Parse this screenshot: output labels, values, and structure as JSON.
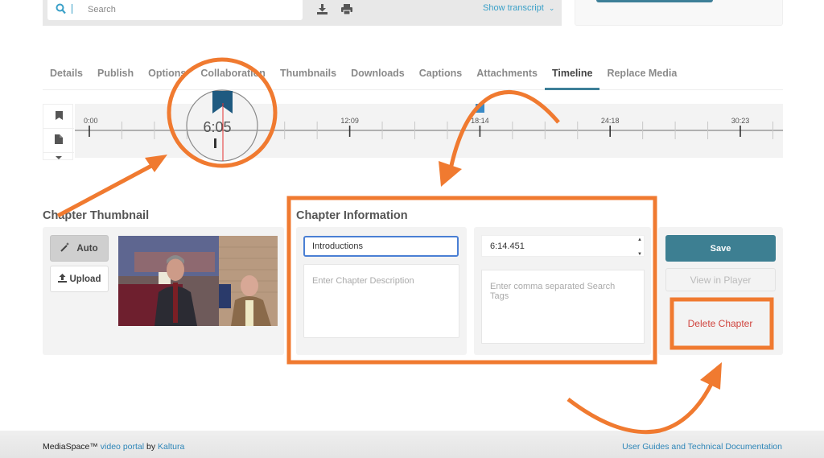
{
  "toolbar": {
    "search_placeholder": "Search",
    "icons": [
      "search-icon",
      "download-icon",
      "print-icon"
    ],
    "show_transcript_label": "Show transcript"
  },
  "tabs": [
    {
      "label": "Details",
      "active": false
    },
    {
      "label": "Publish",
      "active": false
    },
    {
      "label": "Options",
      "active": false
    },
    {
      "label": "Collaboration",
      "active": false
    },
    {
      "label": "Thumbnails",
      "active": false
    },
    {
      "label": "Downloads",
      "active": false
    },
    {
      "label": "Captions",
      "active": false
    },
    {
      "label": "Attachments",
      "active": false
    },
    {
      "label": "Timeline",
      "active": true
    },
    {
      "label": "Replace Media",
      "active": false
    }
  ],
  "timeline": {
    "tools": [
      "bookmark-icon",
      "slide-icon",
      "caret-down-icon"
    ],
    "major_labels": [
      "0:00",
      "12:09",
      "18:14",
      "24:18",
      "30:23"
    ],
    "magnifier_time": "6:05",
    "chapter_marker_time": "6:14",
    "second_marker_time": "18:14"
  },
  "chapter_thumbnail": {
    "title": "Chapter Thumbnail",
    "auto_label": "Auto",
    "upload_label": "Upload"
  },
  "chapter_information": {
    "title": "Chapter Information",
    "chapter_title_value": "Introductions",
    "description_placeholder": "Enter Chapter Description",
    "time_value": "6:14.451",
    "tags_placeholder": "Enter comma separated Search Tags"
  },
  "actions": {
    "save_label": "Save",
    "view_label": "View in Player",
    "delete_label": "Delete Chapter"
  },
  "footer": {
    "brand": "MediaSpace™",
    "link1": "video portal",
    "by": "by",
    "link2": "Kaltura",
    "right_link": "User Guides and Technical Documentation"
  },
  "colors": {
    "accent": "#3d7f92",
    "link": "#3aa0c8",
    "annotation": "#f07a30",
    "delete": "#d0453f",
    "marker": "#1f5a80"
  }
}
